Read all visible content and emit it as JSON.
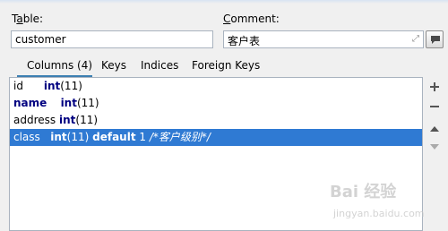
{
  "form": {
    "table_label_u": "a",
    "table_label_pre": "T",
    "table_label_post": "ble:",
    "table_value": "customer",
    "comment_label_u": "C",
    "comment_label_post": "omment:",
    "comment_value": "客户表"
  },
  "tabs": [
    {
      "label": "Columns (4)",
      "active": true
    },
    {
      "label": "Keys",
      "active": false
    },
    {
      "label": "Indices",
      "active": false
    },
    {
      "label": "Foreign Keys",
      "active": false
    }
  ],
  "columns": [
    {
      "name": "id",
      "type": "int",
      "size": "(11)",
      "extra_kw": "",
      "extra": "",
      "comment": ""
    },
    {
      "name": "name",
      "type": "int",
      "size": "(11)",
      "extra_kw": "",
      "extra": "",
      "comment": ""
    },
    {
      "name": "address",
      "type": "int",
      "size": "(11)",
      "extra_kw": "",
      "extra": "",
      "comment": ""
    },
    {
      "name": "class",
      "type": "int",
      "size": "(11)",
      "extra_kw": "default",
      "extra": "1",
      "comment": "/*客户级别*/"
    }
  ],
  "sidebar": {
    "add_icon": "plus-icon",
    "remove_icon": "minus-icon",
    "up_icon": "arrow-up-icon",
    "down_icon": "arrow-down-icon"
  },
  "watermark": {
    "text": "Bai 经验",
    "url": "jingyan.baidu.com"
  },
  "colors": {
    "selection": "#2f7ad3",
    "keyword": "#000080",
    "border": "#a9b3bf"
  }
}
